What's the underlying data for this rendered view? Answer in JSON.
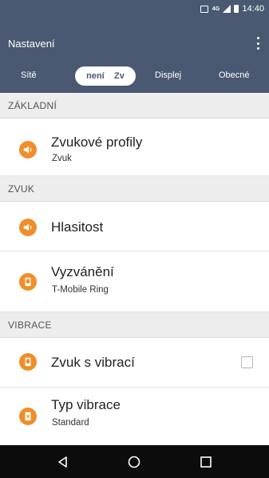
{
  "status_bar": {
    "time": "14:40",
    "icons": [
      "nfc-icon",
      "4g-icon",
      "signal-icon",
      "battery-icon"
    ]
  },
  "app_bar": {
    "title": "Nastavení",
    "menu_icon": "overflow-menu-icon"
  },
  "tabs": [
    {
      "label": "Sítě"
    },
    {
      "label": "není"
    },
    {
      "label": "Zv"
    },
    {
      "label": "Displej"
    },
    {
      "label": "Obecné"
    }
  ],
  "sections": [
    {
      "header": "ZÁKLADNÍ",
      "items": [
        {
          "title": "Zvukové profily",
          "subtitle": "Zvuk",
          "icon": "speaker-icon"
        }
      ]
    },
    {
      "header": "ZVUK",
      "items": [
        {
          "title": "Hlasitost",
          "icon": "speaker-icon"
        },
        {
          "title": "Vyzvánění",
          "subtitle": "T-Mobile Ring",
          "icon": "phone-ring-icon"
        }
      ]
    },
    {
      "header": "VIBRACE",
      "items": [
        {
          "title": "Zvuk s vibrací",
          "icon": "vibrate-icon",
          "checked": false
        },
        {
          "title": "Typ vibrace",
          "subtitle": "Standard",
          "icon": "vibrate-icon"
        }
      ]
    }
  ],
  "colors": {
    "primary": "#4a5971",
    "accent_icon": "#ef8f2b",
    "section_bg": "#ededed",
    "nav_bar": "#0c0c0c"
  },
  "nav_bar": {
    "buttons": [
      "back-icon",
      "home-icon",
      "recents-icon"
    ]
  }
}
